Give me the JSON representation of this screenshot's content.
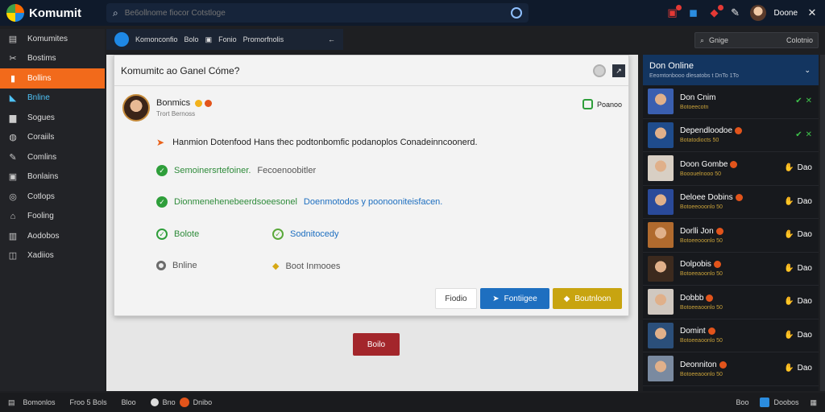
{
  "app": {
    "brand": "Komumit",
    "search_placeholder": "Be6ollnome fiocor Cotstloge",
    "user_name": "Doone",
    "close_glyph": "✕"
  },
  "sidebar": {
    "items": [
      {
        "label": "Komumites",
        "icon": "library-icon",
        "glyph": "▤"
      },
      {
        "label": "Bostims",
        "icon": "tools-icon",
        "glyph": "✂"
      },
      {
        "label": "Bollins",
        "icon": "bookmark-icon",
        "glyph": "▮"
      },
      {
        "label": "Bnline",
        "icon": "online-icon",
        "glyph": "◣"
      },
      {
        "label": "Sogues",
        "icon": "chat-icon",
        "glyph": "▆"
      },
      {
        "label": "Coraiils",
        "icon": "cart-icon",
        "glyph": "◍"
      },
      {
        "label": "Comlins",
        "icon": "pen-icon",
        "glyph": "✎"
      },
      {
        "label": "Bonlains",
        "icon": "gift-icon",
        "glyph": "▣"
      },
      {
        "label": "Cotlops",
        "icon": "gear-icon",
        "glyph": "◎"
      },
      {
        "label": "Fooling",
        "icon": "home-icon",
        "glyph": "⌂"
      },
      {
        "label": "Aodobos",
        "icon": "folder-icon",
        "glyph": "▥"
      },
      {
        "label": "Xadiios",
        "icon": "wallet-icon",
        "glyph": "◫"
      }
    ]
  },
  "subbar": {
    "items": [
      "Komonconfio",
      "Bolo",
      "Fonio",
      "Promorfnolis"
    ],
    "close": "←"
  },
  "secondary_search": {
    "label": "Gnige",
    "right": "Colotnio"
  },
  "dialog": {
    "title": "Komumitc ao Ganel Cóme?",
    "person": {
      "name": "Bonmics",
      "sub": "Trort Bernoss"
    },
    "status": "Poanoo",
    "message": "Hanmion Dotenfood Hans thec podtonbomfic podanoplos Conadeinncoonerd.",
    "line1": {
      "green": "Semoinersrtefoiner.",
      "gray": "Fecoenoobitler"
    },
    "line2": {
      "green": "Dionmenehenebeerdsoeesonel",
      "blue": "Doenmotodos y poonooniteisfacen."
    },
    "opt1": "Bolote",
    "opt2": "Sodnitocedy",
    "opt3": "Bnline",
    "opt4": "Boot Inmooes",
    "buttons": {
      "cancel": "Fiodio",
      "primary": "Fontiigee",
      "secondary": "Boutnloon"
    },
    "below_button": "Boilo"
  },
  "right_panel": {
    "title": "Don Online",
    "sub": "Eeomtonbooo dlesatobs t DnTo 1To",
    "friends": [
      {
        "name": "Don Cnim",
        "sub": "Botoeecotn",
        "status": "",
        "check": true,
        "emoji": false
      },
      {
        "name": "Dependloodoe",
        "sub": "Botatodiocts 50",
        "status": "",
        "check": true,
        "emoji": true
      },
      {
        "name": "Doon Gombe",
        "sub": "Booouelnooo 50",
        "status": "Dao",
        "check": false,
        "emoji": true
      },
      {
        "name": "Deloee Dobins",
        "sub": "Botoeeooonlo 50",
        "status": "Dao",
        "check": false,
        "emoji": true
      },
      {
        "name": "Dorlli Jon",
        "sub": "Botoeeooonlo 50",
        "status": "Dao",
        "check": false,
        "emoji": true
      },
      {
        "name": "Dolpobis",
        "sub": "Botoeeaoonlo 50",
        "status": "Dao",
        "check": false,
        "emoji": true
      },
      {
        "name": "Dobbb",
        "sub": "Botoeeaoonlo 50",
        "status": "Dao",
        "check": false,
        "emoji": true
      },
      {
        "name": "Domint",
        "sub": "Botoeeaoonlo 50",
        "status": "Dao",
        "check": false,
        "emoji": true
      },
      {
        "name": "Deonniton",
        "sub": "Botoeeaoonlo 50",
        "status": "Dao",
        "check": false,
        "emoji": true
      }
    ]
  },
  "statusbar": {
    "left": "Bomonlos",
    "mid1": "Froo 5 Bols",
    "mid2": "Bloo",
    "mid3": "Bno",
    "mid4": "Dnibo",
    "right1": "Boo",
    "right2": "Doobos"
  },
  "colors": {
    "accent_orange": "#f26a1b",
    "online_blue": "#4fc3f7",
    "success_green": "#2e9e3a",
    "primary_blue": "#1e6fc0",
    "warning_yellow": "#c8a410",
    "danger_red": "#a3262b",
    "panel_header_blue": "#133560"
  }
}
